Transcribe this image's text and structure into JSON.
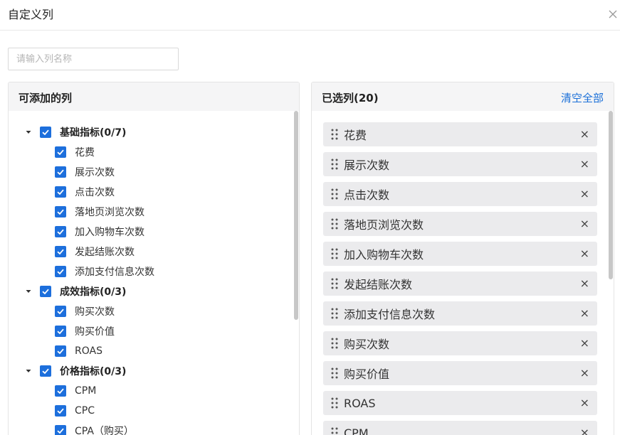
{
  "dialog": {
    "title": "自定义列",
    "close_icon": "close-icon",
    "search_placeholder": "请输入列名称"
  },
  "available": {
    "title": "可添加的列",
    "groups": [
      {
        "label": "基础指标(0/7)",
        "items": [
          "花费",
          "展示次数",
          "点击次数",
          "落地页浏览次数",
          "加入购物车次数",
          "发起结账次数",
          "添加支付信息次数"
        ]
      },
      {
        "label": "成效指标(0/3)",
        "items": [
          "购买次数",
          "购买价值",
          "ROAS"
        ]
      },
      {
        "label": "价格指标(0/3)",
        "items": [
          "CPM",
          "CPC",
          "CPA（购买）"
        ]
      }
    ]
  },
  "selected": {
    "title": "已选列(20)",
    "clear_label": "清空全部",
    "items": [
      "花费",
      "展示次数",
      "点击次数",
      "落地页浏览次数",
      "加入购物车次数",
      "发起结账次数",
      "添加支付信息次数",
      "购买次数",
      "购买价值",
      "ROAS",
      "CPM"
    ],
    "remove_glyph": "×"
  },
  "colors": {
    "accent": "#1d6fdc",
    "link": "#1a6fd8",
    "chip_bg": "#ebebed",
    "panel_head_bg": "#f5f5f6"
  }
}
